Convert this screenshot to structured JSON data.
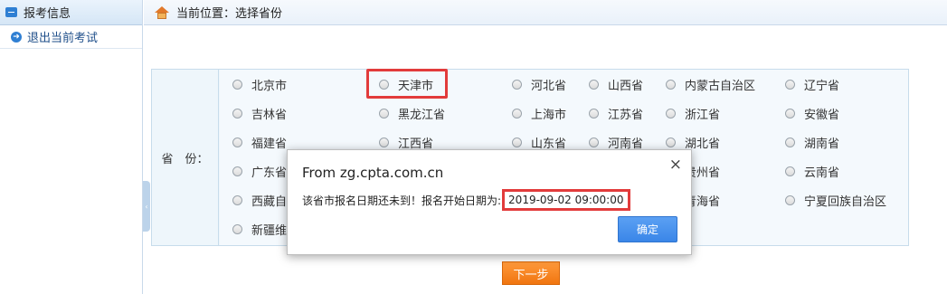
{
  "sidebar": {
    "title": "报考信息",
    "items": [
      {
        "label": "退出当前考试"
      }
    ]
  },
  "topbar": {
    "breadcrumb": "当前位置：选择省份"
  },
  "form": {
    "province_label": "省　份：",
    "provinces": [
      "北京市",
      "天津市",
      "河北省",
      "山西省",
      "内蒙古自治区",
      "辽宁省",
      "吉林省",
      "黑龙江省",
      "上海市",
      "江苏省",
      "浙江省",
      "安徽省",
      "福建省",
      "江西省",
      "山东省",
      "河南省",
      "湖北省",
      "湖南省",
      "广东省",
      "贵州省",
      "云南省",
      "西藏自",
      "青海省",
      "宁夏回族自治区",
      "新疆维"
    ],
    "next_label": "下一步"
  },
  "dialog": {
    "title": "From zg.cpta.com.cn",
    "message": "该省市报名日期还未到！报名开始日期为:",
    "date": "2019-09-02 09:00:00",
    "ok_label": "确定",
    "close_symbol": "×"
  },
  "colors": {
    "accent": "#3a86e8",
    "highlight": "#e23b3b",
    "next_button": "#f07510"
  }
}
